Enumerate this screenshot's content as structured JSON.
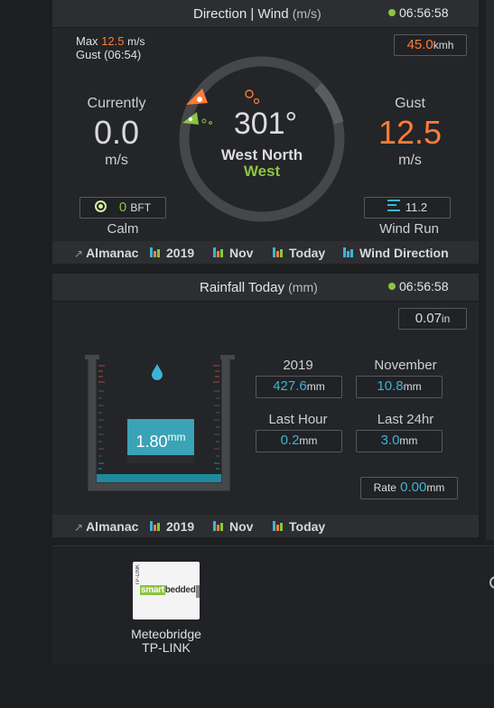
{
  "colors": {
    "accent": "#ff7c39",
    "rain": "#3db4d6",
    "live": "#8bc53f"
  },
  "wind": {
    "title": "Direction | Wind",
    "title_unit": "(m/s)",
    "time": "06:56:58",
    "max_label": "Max",
    "max_value": "12.5",
    "max_unit": "m/s",
    "gust_time": "Gust (06:54)",
    "kmh_value": "45.0",
    "kmh_unit": "kmh",
    "currently_label": "Currently",
    "current_value": "0.0",
    "current_unit": "m/s",
    "gust_label": "Gust",
    "gust_value": "12.5",
    "gust_unit": "m/s",
    "degrees": "301°",
    "dir_line1": "West North",
    "dir_line2": "West",
    "bft_value": "0",
    "bft_unit": "BFT",
    "bft_desc": "Calm",
    "run_value": "11.2",
    "run_label": "Wind Run"
  },
  "wind_footer": [
    "Almanac",
    "2019",
    "Nov",
    "Today",
    "Wind Direction"
  ],
  "rain": {
    "title": "Rainfall Today",
    "title_unit": "(mm)",
    "time": "06:56:58",
    "inch_value": "0.07",
    "inch_unit": "in",
    "gauge_value": "1.80",
    "gauge_unit": "mm",
    "year_label": "2019",
    "year_value": "427.6",
    "year_unit": "mm",
    "month_label": "November",
    "month_value": "10.8",
    "month_unit": "mm",
    "hour_label": "Last Hour",
    "hour_value": "0.2",
    "hour_unit": "mm",
    "day_label": "Last 24hr",
    "day_value": "3.0",
    "day_unit": "mm",
    "rate_label": "Rate",
    "rate_value": "0.00",
    "rate_unit": "mm"
  },
  "rain_footer": [
    "Almanac",
    "2019",
    "Nov",
    "Today"
  ],
  "device": {
    "logo_text_a": "smart",
    "logo_text_b": "bedded",
    "vendor_small": "TP-LINK",
    "name_line1": "Meteobridge",
    "name_line2": "TP-LINK"
  }
}
